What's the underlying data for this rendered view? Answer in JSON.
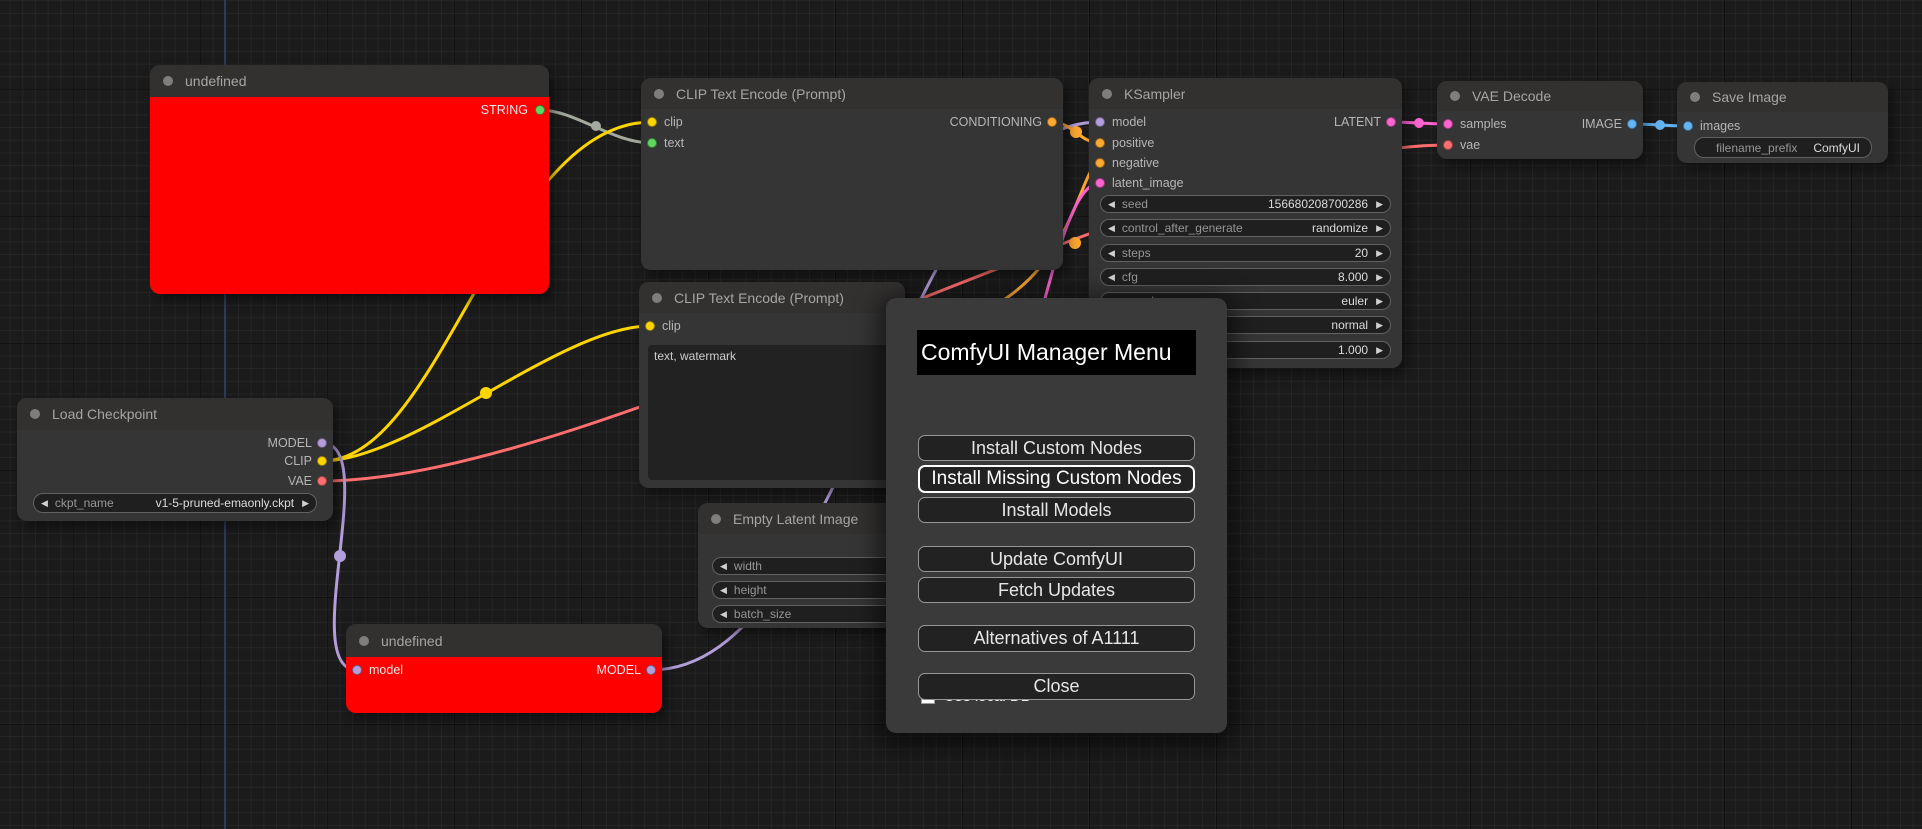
{
  "type_colors": {
    "string_port": "#5ed85e",
    "string_link": "#a3a99e",
    "clip": "#ffd500",
    "conditioning": "#ffa931",
    "model": "#b39ddb",
    "latent": "#ff64d0",
    "vae": "#ff6e6e",
    "image": "#64b5f6"
  },
  "nodes": {
    "undefined_top": {
      "title": "undefined",
      "output": "STRING",
      "body_color": "#fe0000"
    },
    "clip_encode_pos": {
      "title": "CLIP Text Encode (Prompt)",
      "input_clip": "clip",
      "input_text": "text",
      "output": "CONDITIONING"
    },
    "clip_encode_neg": {
      "title": "CLIP Text Encode (Prompt)",
      "input_clip": "clip",
      "prompt_text": "text, watermark"
    },
    "ksampler": {
      "title": "KSampler",
      "inputs": [
        "model",
        "positive",
        "negative",
        "latent_image"
      ],
      "output": "LATENT",
      "widgets": [
        {
          "label": "seed",
          "value": "156680208700286"
        },
        {
          "label": "control_after_generate",
          "value": "randomize"
        },
        {
          "label": "steps",
          "value": "20"
        },
        {
          "label": "cfg",
          "value": "8.000"
        },
        {
          "label": "sampler_name",
          "value": "euler"
        },
        {
          "label": "",
          "value": "normal"
        },
        {
          "label": "",
          "value": "1.000"
        }
      ]
    },
    "vae_decode": {
      "title": "VAE Decode",
      "input_samples": "samples",
      "input_vae": "vae",
      "output": "IMAGE"
    },
    "save_image": {
      "title": "Save Image",
      "input_images": "images",
      "widget": {
        "label": "filename_prefix",
        "value": "ComfyUI"
      }
    },
    "load_checkpoint": {
      "title": "Load Checkpoint",
      "outputs": [
        "MODEL",
        "CLIP",
        "VAE"
      ],
      "widget": {
        "label": "ckpt_name",
        "value": "v1-5-pruned-emaonly.ckpt"
      }
    },
    "empty_latent": {
      "title": "Empty Latent Image",
      "widgets": [
        {
          "label": "width",
          "value": ""
        },
        {
          "label": "height",
          "value": ""
        },
        {
          "label": "batch_size",
          "value": ""
        }
      ]
    },
    "undefined_bottom": {
      "title": "undefined",
      "input": "model",
      "output": "MODEL",
      "body_color": "#fe0000"
    }
  },
  "dialog": {
    "title": "ComfyUI Manager Menu",
    "checkbox_label": "Use local DB",
    "checkbox_checked": false,
    "buttons": [
      "Install Custom Nodes",
      "Install Missing Custom Nodes",
      "Install Models",
      "Update ComfyUI",
      "Fetch Updates",
      "Alternatives of A1111",
      "Close"
    ]
  }
}
